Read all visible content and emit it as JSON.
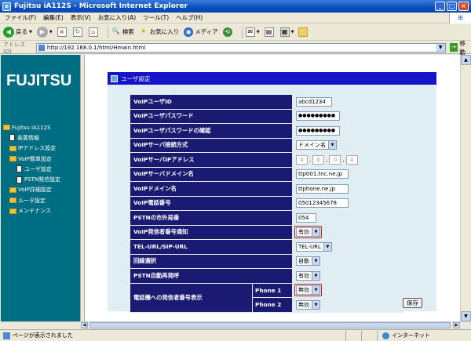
{
  "window": {
    "title": "Fujitsu iA112S - Microsoft Internet Explorer"
  },
  "menu": [
    "ファイル(F)",
    "編集(E)",
    "表示(V)",
    "お気に入り(A)",
    "ツール(T)",
    "ヘルプ(H)"
  ],
  "toolbar": {
    "back": "戻る",
    "search": "検索",
    "favorites": "お気に入り",
    "media": "メディア"
  },
  "address": {
    "label": "アドレス(D)",
    "url": "http://192.168.0.1/html/Hmain.html",
    "go": "移動"
  },
  "sidebar": {
    "logo": "FUJITSU",
    "items": [
      {
        "label": "Fujitsu iA112S",
        "type": "root"
      },
      {
        "label": "装置情報",
        "type": "doc"
      },
      {
        "label": "IPアドレス設定",
        "type": "folder"
      },
      {
        "label": "VoIP簡単設定",
        "type": "folder"
      },
      {
        "label": "ユーザ設定",
        "type": "doc2"
      },
      {
        "label": "PSTN発信設定",
        "type": "doc2"
      },
      {
        "label": "VoIP詳細設定",
        "type": "folder"
      },
      {
        "label": "ルータ設定",
        "type": "folder"
      },
      {
        "label": "メンテナンス",
        "type": "folder"
      }
    ]
  },
  "panel": {
    "title": "ユーザ設定",
    "rows": [
      {
        "label": "VoIPユーザID",
        "value": "abcd1234"
      },
      {
        "label": "VoIPユーザパスワード",
        "value": "●●●●●●●●●"
      },
      {
        "label": "VoIPユーザパスワードの確認",
        "value": "●●●●●●●●●"
      },
      {
        "label": "VoIPサーバ接続方式",
        "value": "ドメイン名"
      },
      {
        "label": "VoIPサーバIPアドレス",
        "ip": [
          "0",
          "0",
          "0",
          "0"
        ]
      },
      {
        "label": "VoIPサーバドメイン名",
        "value": "ttp001.tnc.ne.jp"
      },
      {
        "label": "VoIPドメイン名",
        "value": "ttphone.ne.jp"
      },
      {
        "label": "VoIP電話番号",
        "value": "05012345678"
      },
      {
        "label": "PSTNの市外局番",
        "value": "054"
      },
      {
        "label": "VoIP発信者番号通知",
        "value": "有効"
      },
      {
        "label": "TEL-URL/SIP-URL",
        "value": "TEL-URL"
      },
      {
        "label": "回線選択",
        "value": "自動"
      },
      {
        "label": "PSTN自動再発呼",
        "value": "有効"
      }
    ],
    "caller_display": {
      "label": "電話機への発信者番号表示",
      "phone1": {
        "label": "Phone 1",
        "value": "無効"
      },
      "phone2": {
        "label": "Phone 2",
        "value": "無効"
      }
    },
    "save": "保存"
  },
  "status": {
    "text": "ページが表示されました",
    "zone": "インターネット"
  },
  "colors": {
    "header": "#1414c8",
    "label_bg": "#1a1a72",
    "sidebar_bg": "#006e82",
    "highlight": "#c01818"
  }
}
